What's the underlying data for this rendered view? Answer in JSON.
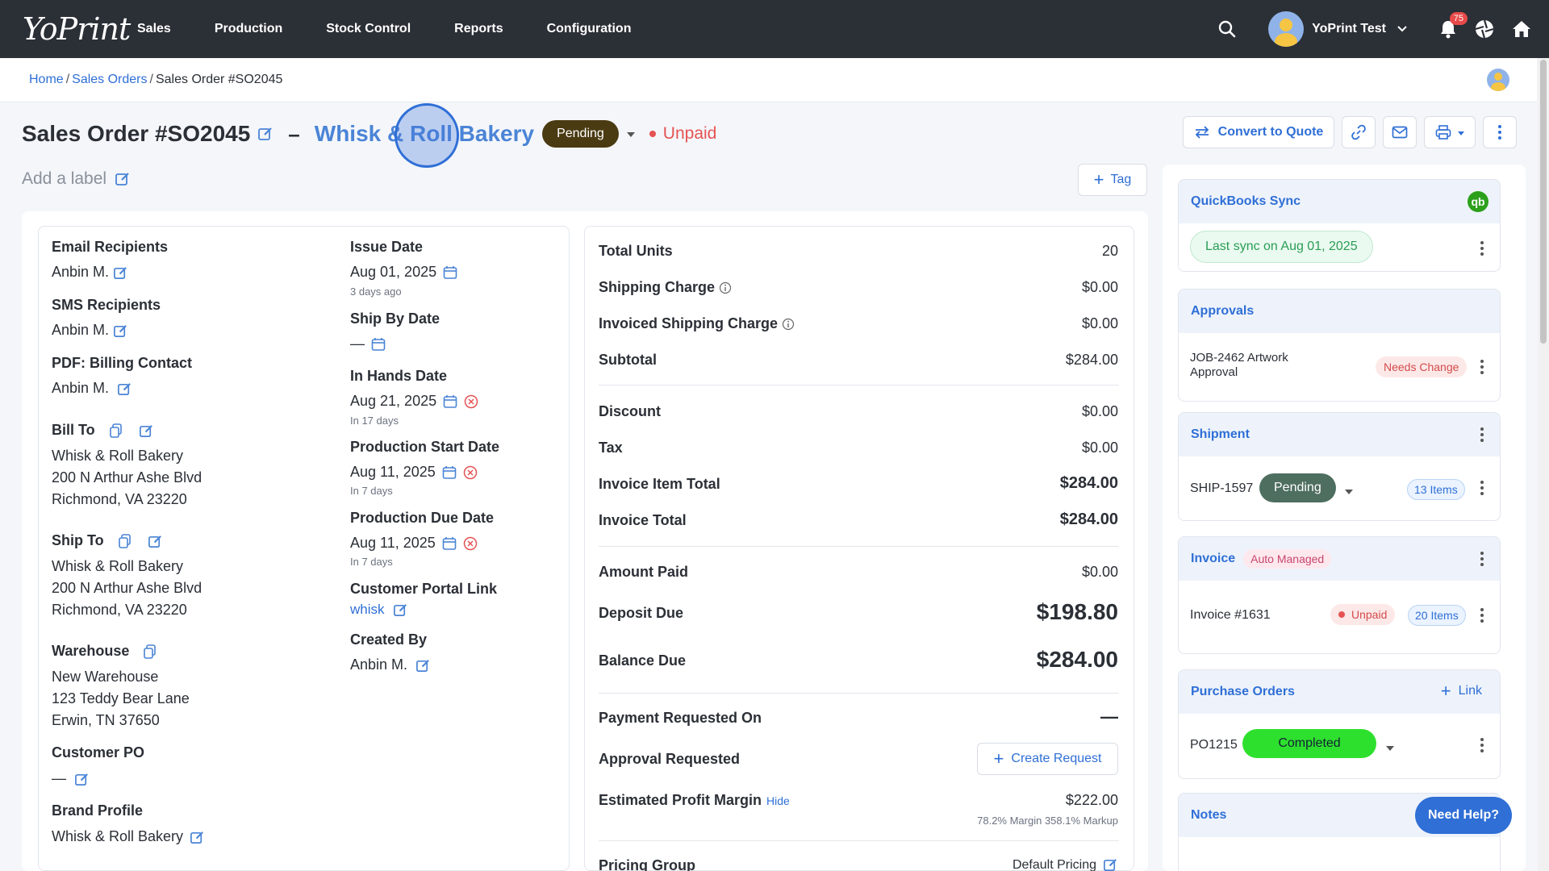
{
  "nav": {
    "logo": "YoPrint",
    "items": [
      "Sales",
      "Production",
      "Stock Control",
      "Reports",
      "Configuration"
    ],
    "user_name": "YoPrint Test",
    "notification_count": "75",
    "icons": [
      "search-icon",
      "bell-icon",
      "aperture-icon",
      "home-icon"
    ]
  },
  "breadcrumb": {
    "home": "Home",
    "sales_orders": "Sales Orders",
    "current": "Sales Order #SO2045",
    "sep": "/"
  },
  "header": {
    "title": "Sales Order #SO2045",
    "dash": "–",
    "customer": "Whisk & Roll Bakery",
    "status": "Pending",
    "payment_status": "Unpaid",
    "add_label": "Add a label",
    "tag_button": "Tag",
    "convert_button": "Convert to Quote"
  },
  "details": {
    "email_recipients_label": "Email Recipients",
    "email_recipients": "Anbin M.",
    "sms_recipients_label": "SMS Recipients",
    "sms_recipients": "Anbin M.",
    "pdf_billing_label": "PDF: Billing Contact",
    "pdf_billing": "Anbin M.",
    "bill_to_label": "Bill To",
    "bill_to": [
      "Whisk & Roll Bakery",
      "200 N Arthur Ashe Blvd",
      "Richmond, VA 23220"
    ],
    "ship_to_label": "Ship To",
    "ship_to": [
      "Whisk & Roll Bakery",
      "200 N Arthur Ashe Blvd",
      "Richmond, VA 23220"
    ],
    "warehouse_label": "Warehouse",
    "warehouse": [
      "New Warehouse",
      "123 Teddy Bear Lane",
      "Erwin, TN 37650"
    ],
    "customer_po_label": "Customer PO",
    "customer_po": "—",
    "brand_profile_label": "Brand Profile",
    "brand_profile": "Whisk & Roll Bakery",
    "issue_date_label": "Issue Date",
    "issue_date": "Aug 01, 2025",
    "issue_date_rel": "3 days ago",
    "ship_by_label": "Ship By Date",
    "ship_by": "—",
    "in_hands_label": "In Hands Date",
    "in_hands": "Aug 21, 2025",
    "in_hands_rel": "In 17 days",
    "prod_start_label": "Production Start Date",
    "prod_start": "Aug 11, 2025",
    "prod_start_rel": "In 7 days",
    "prod_due_label": "Production Due Date",
    "prod_due": "Aug 11, 2025",
    "prod_due_rel": "In 7 days",
    "portal_label": "Customer Portal Link",
    "portal": "whisk",
    "created_by_label": "Created By",
    "created_by": "Anbin M."
  },
  "totals": {
    "total_units_label": "Total Units",
    "total_units": "20",
    "shipping_label": "Shipping Charge",
    "shipping": "$0.00",
    "inv_shipping_label": "Invoiced Shipping Charge",
    "inv_shipping": "$0.00",
    "subtotal_label": "Subtotal",
    "subtotal": "$284.00",
    "discount_label": "Discount",
    "discount": "$0.00",
    "tax_label": "Tax",
    "tax": "$0.00",
    "item_total_label": "Invoice Item Total",
    "item_total": "$284.00",
    "invoice_total_label": "Invoice Total",
    "invoice_total": "$284.00",
    "amount_paid_label": "Amount Paid",
    "amount_paid": "$0.00",
    "deposit_due_label": "Deposit Due",
    "deposit_due": "$198.80",
    "balance_due_label": "Balance Due",
    "balance_due": "$284.00",
    "payment_req_label": "Payment Requested On",
    "payment_req": "—",
    "approval_req_label": "Approval Requested",
    "create_request": "Create Request",
    "profit_label": "Estimated Profit Margin",
    "profit_hide": "Hide",
    "profit": "$222.00",
    "profit_sub": "78.2% Margin 358.1% Markup",
    "pricing_label": "Pricing Group",
    "pricing": "Default Pricing"
  },
  "sidebar": {
    "qb_title": "QuickBooks Sync",
    "qb_sync": "Last sync on Aug 01, 2025",
    "approvals_title": "Approvals",
    "approval_item": "JOB-2462 Artwork Approval",
    "approval_status": "Needs Change",
    "shipment_title": "Shipment",
    "shipment_id": "SHIP-1597",
    "shipment_status": "Pending",
    "shipment_items": "13 Items",
    "invoice_title": "Invoice",
    "invoice_tag": "Auto Managed",
    "invoice_id": "Invoice #1631",
    "invoice_status": "Unpaid",
    "invoice_items": "20 Items",
    "po_title": "Purchase Orders",
    "po_link": "Link",
    "po_id": "PO1215",
    "po_status": "Completed",
    "notes_title": "Notes"
  },
  "help": "Need Help?",
  "colors": {
    "nav_bg": "#2b2f36",
    "accent": "#2f6fd6",
    "pending": "#4b3b12",
    "unpaid": "#e55353",
    "completed": "#2ee02e",
    "shipment_pending": "#4e6e60"
  }
}
